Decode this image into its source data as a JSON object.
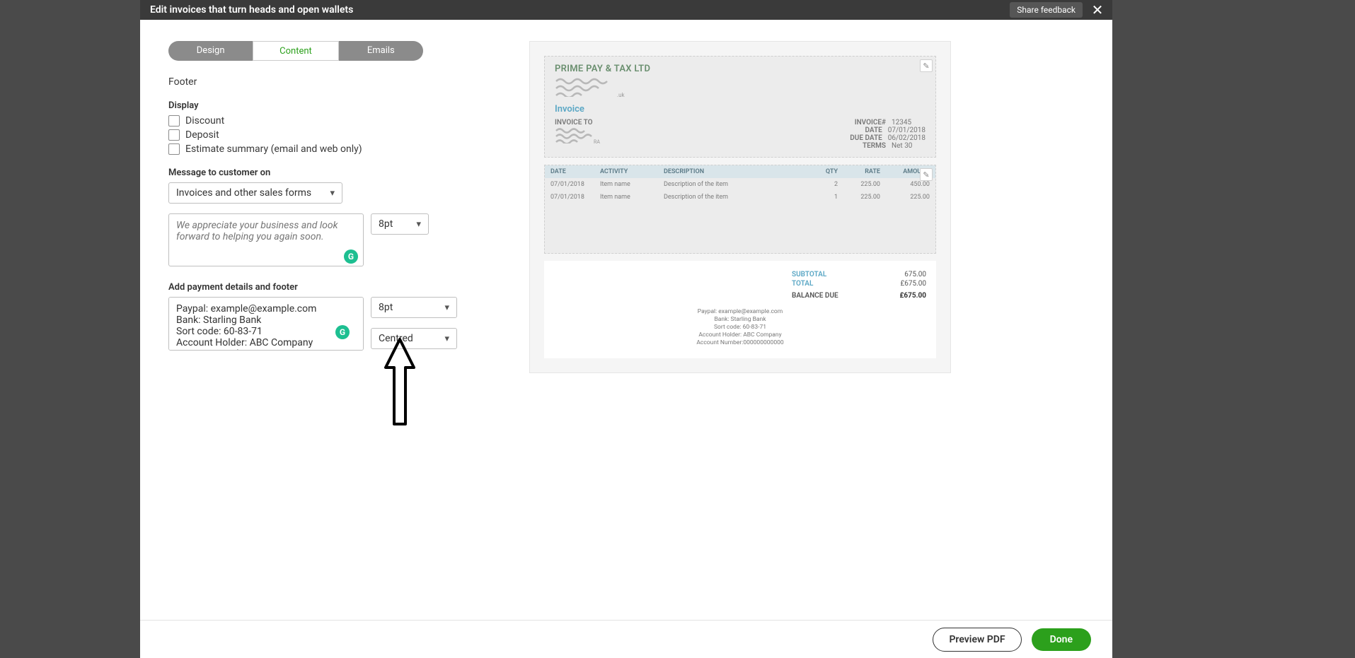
{
  "header": {
    "title": "Edit invoices that turn heads and open wallets",
    "share_label": "Share feedback"
  },
  "tabs": {
    "design": "Design",
    "content": "Content",
    "emails": "Emails"
  },
  "section": {
    "footer": "Footer"
  },
  "display": {
    "label": "Display",
    "discount": "Discount",
    "deposit": "Deposit",
    "estimate": "Estimate summary (email and web only)"
  },
  "message": {
    "label": "Message to customer on",
    "select": "Invoices and other sales forms",
    "placeholder": "We appreciate your business and look forward to helping you again soon.",
    "font": "8pt"
  },
  "footer_details": {
    "label": "Add payment details and footer",
    "text": "Paypal: example@example.com\nBank: Starling Bank\nSort code: 60-83-71\nAccount Holder: ABC Company\nAccount Number:000000000000",
    "font": "8pt",
    "align": "Centred"
  },
  "preview": {
    "company": "PRIME PAY & TAX LTD",
    "invoice_word": "Invoice",
    "invoice_to_label": "INVOICE TO",
    "meta": {
      "invoice_no_k": "INVOICE#",
      "invoice_no_v": "12345",
      "date_k": "DATE",
      "date_v": "07/01/2018",
      "due_k": "DUE DATE",
      "due_v": "06/02/2018",
      "terms_k": "TERMS",
      "terms_v": "Net 30"
    },
    "cols": {
      "date": "DATE",
      "activity": "ACTIVITY",
      "desc": "DESCRIPTION",
      "qty": "QTY",
      "rate": "RATE",
      "amount": "AMOUNT"
    },
    "rows": [
      {
        "date": "07/01/2018",
        "activity": "Item name",
        "desc": "Description of the item",
        "qty": "2",
        "rate": "225.00",
        "amount": "450.00"
      },
      {
        "date": "07/01/2018",
        "activity": "Item name",
        "desc": "Description of the item",
        "qty": "1",
        "rate": "225.00",
        "amount": "225.00"
      }
    ],
    "totals": {
      "subtotal_k": "SUBTOTAL",
      "subtotal_v": "675.00",
      "total_k": "TOTAL",
      "total_v": "£675.00",
      "balance_k": "BALANCE DUE",
      "balance_v": "£675.00"
    },
    "footer_lines": [
      "Paypal: example@example.com",
      "Bank: Starling Bank",
      "Sort code: 60-83-71",
      "Account Holder: ABC Company",
      "Account Number:000000000000"
    ]
  },
  "buttons": {
    "preview": "Preview PDF",
    "done": "Done"
  }
}
